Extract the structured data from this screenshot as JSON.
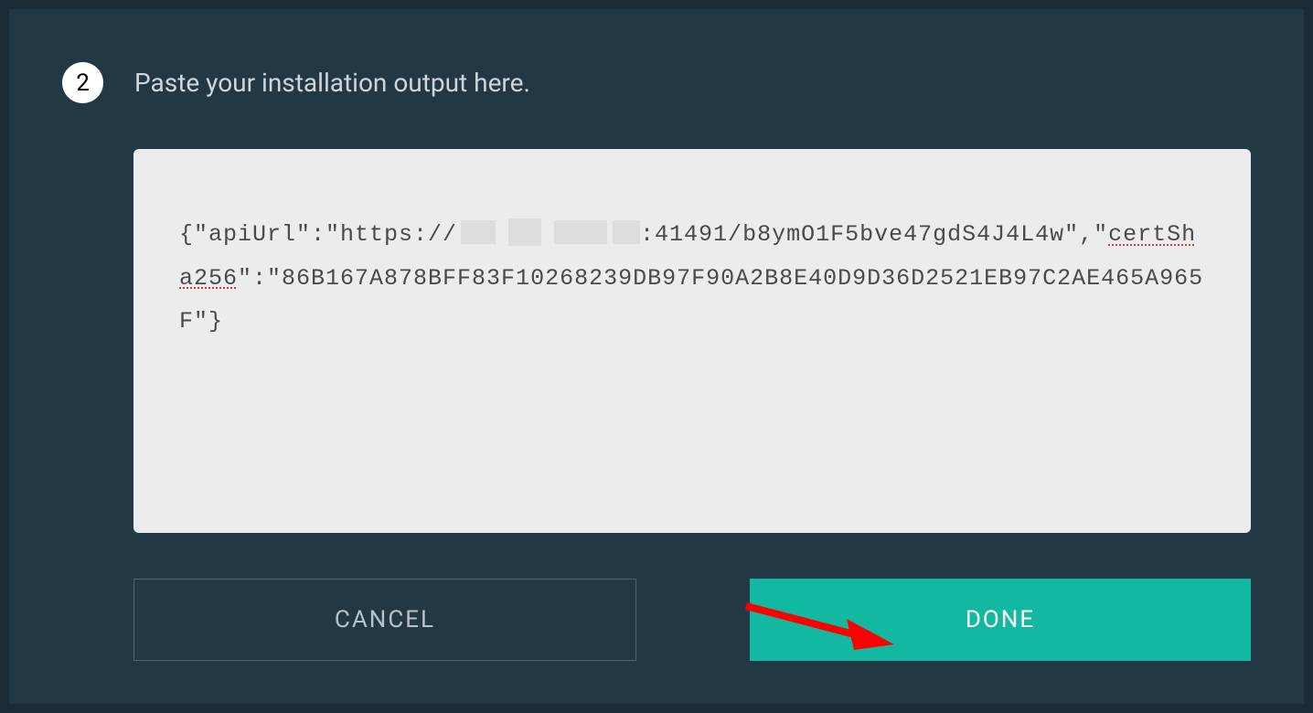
{
  "step": {
    "number": "2",
    "title": "Paste your installation output here."
  },
  "output": {
    "seg1": "{\"apiUrl\":\"https://",
    "seg2": ":41491/b8ymO1F5bve47gdS4J4L4w\",\"",
    "spell_cert": "cert",
    "spell_sha": "Sha256",
    "seg3": "\":\"86B167A878BFF83F10268239DB97F90A2B8E40D9D36D2521EB97C2AE465A965F\"}"
  },
  "buttons": {
    "cancel": "CANCEL",
    "done": "DONE"
  }
}
